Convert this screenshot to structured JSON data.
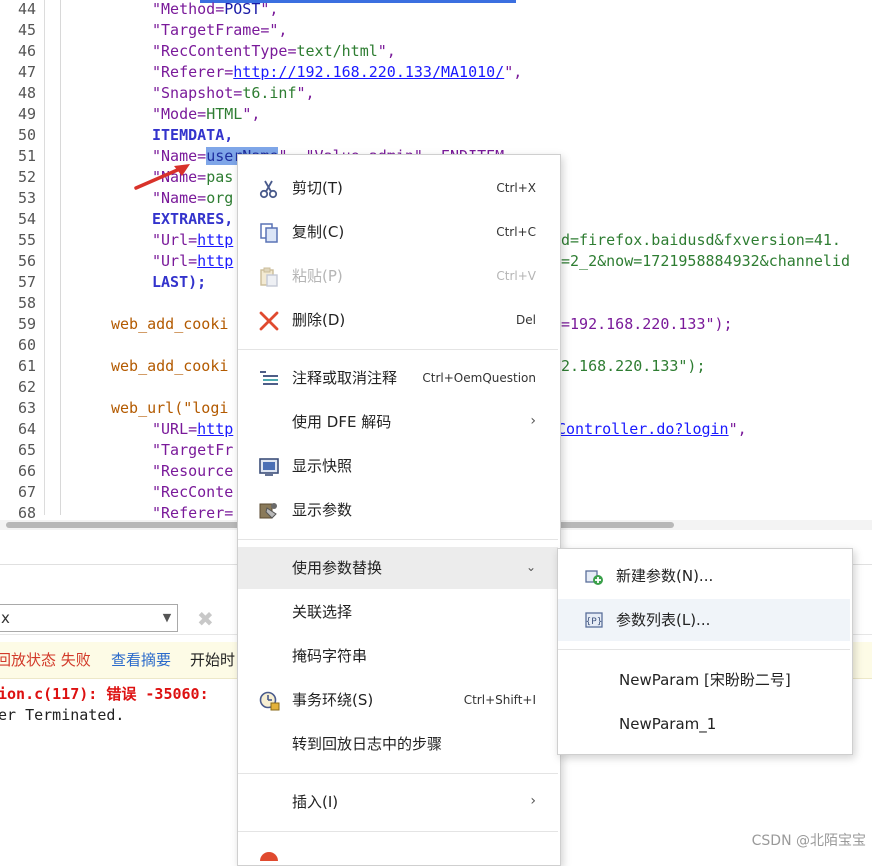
{
  "editor": {
    "line_numbers": [
      "44",
      "45",
      "46",
      "47",
      "48",
      "49",
      "50",
      "51",
      "52",
      "53",
      "54",
      "55",
      "56",
      "57",
      "58",
      "59",
      "60",
      "61",
      "62",
      "63",
      "64",
      "65",
      "66",
      "67",
      "68"
    ],
    "lines": {
      "l44": [
        "\"Method=",
        "POST",
        "\","
      ],
      "l45": [
        "\"TargetFrame=\","
      ],
      "l46": [
        "\"RecContentType=",
        "text/html",
        "\","
      ],
      "l47": [
        "\"Referer=",
        "http://192.168.220.133/MA1010/",
        "\","
      ],
      "l48": [
        "\"Snapshot=",
        "t6.inf",
        "\","
      ],
      "l49": [
        "\"Mode=",
        "HTML",
        "\","
      ],
      "l50": [
        "ITEMDATA,"
      ],
      "l51": [
        "\"Name=",
        "userName",
        "\", \"Value=admin\", ENDITEM,"
      ],
      "l52": [
        "\"Name=",
        "pas"
      ],
      "l53": [
        "\"Name=",
        "org"
      ],
      "l54": [
        "EXTRARES,"
      ],
      "l55": [
        "\"Url=",
        "http",
        "d=firefox.baidusd&fxversion=41."
      ],
      "l56": [
        "\"Url=",
        "http",
        "=2_2&now=1721958884932&channelid"
      ],
      "l57": [
        "LAST);"
      ],
      "l59": [
        "web_add_cooki",
        "=192.168.220.133\");"
      ],
      "l61": [
        "web_add_cooki",
        "2.168.220.133\");"
      ],
      "l63": [
        "web_url(\"logi"
      ],
      "l64": [
        "\"URL=",
        "http",
        "Controller.do?login",
        "\","
      ],
      "l65": [
        "\"TargetFr"
      ],
      "l66": [
        "\"Resource"
      ],
      "l67": [
        "\"RecConte"
      ],
      "l68": [
        "\"Referer="
      ]
    }
  },
  "lower_panel": {
    "filter_value": "x",
    "status_fail": "回放状态 失败",
    "status_summary": "查看摘要",
    "status_start": "开始时",
    "error_line": "ion.c(117): 错误 -35060:",
    "terminated_line": "er Terminated."
  },
  "context_menu": {
    "items": [
      {
        "label": "剪切(T)",
        "shortcut": "Ctrl+X",
        "icon": "scissors-icon"
      },
      {
        "label": "复制(C)",
        "shortcut": "Ctrl+C",
        "icon": "copy-icon"
      },
      {
        "label": "粘贴(P)",
        "shortcut": "Ctrl+V",
        "icon": "paste-icon"
      },
      {
        "label": "删除(D)",
        "shortcut": "Del",
        "icon": "delete-icon"
      },
      {
        "label": "注释或取消注释",
        "shortcut": "Ctrl+OemQuestion",
        "icon": "comment-icon"
      },
      {
        "label": "使用 DFE 解码",
        "icon": "none"
      },
      {
        "label": "显示快照",
        "icon": "snapshot-icon"
      },
      {
        "label": "显示参数",
        "icon": "parameters-icon"
      },
      {
        "label": "使用参数替换",
        "icon": "none"
      },
      {
        "label": "关联选择",
        "icon": "none"
      },
      {
        "label": "掩码字符串",
        "icon": "none"
      },
      {
        "label": "事务环绕(S)",
        "shortcut": "Ctrl+Shift+I",
        "icon": "transaction-icon"
      },
      {
        "label": "转到回放日志中的步骤",
        "icon": "none"
      },
      {
        "label": "插入(I)",
        "icon": "none"
      }
    ]
  },
  "submenu": {
    "items": [
      {
        "label": "新建参数(N)...",
        "icon": "new-parameter-icon"
      },
      {
        "label": "参数列表(L)...",
        "icon": "parameter-list-icon"
      },
      {
        "label": "NewParam [宋盼盼二号]"
      },
      {
        "label": "NewParam_1"
      }
    ]
  },
  "watermark": "CSDN @北陌宝宝",
  "colors": {
    "string": "#7a1a9a",
    "keyword": "#1a1aa6",
    "value": "#2e7d32",
    "link": "#1a1aff",
    "function": "#b35a00",
    "selection": "#7fa6e8",
    "error": "#d11111",
    "arrow": "#d8322a"
  }
}
